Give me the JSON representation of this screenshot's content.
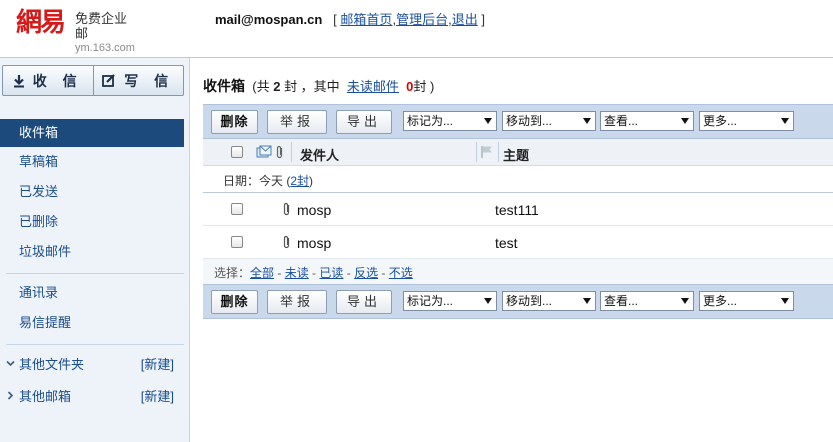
{
  "brand": {
    "logo_text": "網易",
    "product": "免费企业邮",
    "domain": "ym.163.com"
  },
  "topbar": {
    "email": "mail@mospan.cn",
    "open_bracket": "[",
    "close_bracket": "]",
    "links": [
      "邮箱首页",
      "管理后台",
      "退出"
    ],
    "separator": ","
  },
  "sidebar": {
    "receive_label": "收 信",
    "compose_label": "写 信",
    "nav": [
      {
        "label": "收件箱",
        "active": true
      },
      {
        "label": "草稿箱"
      },
      {
        "label": "已发送"
      },
      {
        "label": "已删除"
      },
      {
        "label": "垃圾邮件"
      }
    ],
    "nav2": [
      {
        "label": "通讯录"
      },
      {
        "label": "易信提醒"
      }
    ],
    "folders": [
      {
        "label": "其他文件夹",
        "action": "[新建]",
        "chevron": "down"
      },
      {
        "label": "其他邮箱",
        "action": "[新建]",
        "chevron": "right"
      }
    ]
  },
  "inbox": {
    "title": "收件箱",
    "summary_prefix": "(共",
    "total": "2",
    "summary_mid": "封 ，其中",
    "unread_label": "未读邮件",
    "unread_count": "0",
    "summary_suffix": "封 )"
  },
  "toolbar": {
    "delete": "删除",
    "report": "举报",
    "export": "导出",
    "mark_as": "标记为...",
    "move_to": "移动到...",
    "view": "查看...",
    "more": "更多..."
  },
  "columns": {
    "sender": "发件人",
    "subject": "主题"
  },
  "date_group": {
    "label": "日期：今天",
    "open_paren": "(",
    "count_link": "2封",
    "close_paren": ")"
  },
  "mails": [
    {
      "sender": "mosp",
      "subject": "test111",
      "has_attachment": true
    },
    {
      "sender": "mosp",
      "subject": "test",
      "has_attachment": true
    }
  ],
  "select_bar": {
    "label": "选择：",
    "options": [
      "全部",
      "未读",
      "已读",
      "反选",
      "不选"
    ],
    "separator": " - "
  }
}
